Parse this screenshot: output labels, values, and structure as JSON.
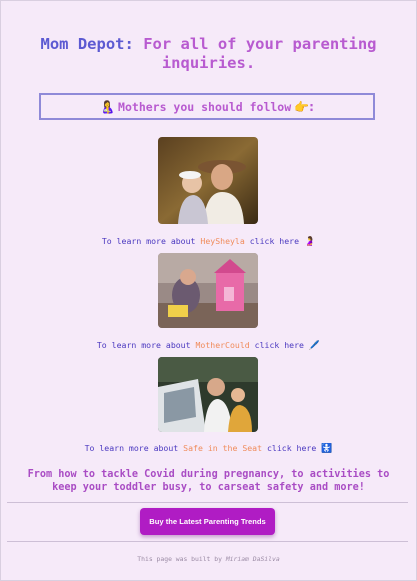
{
  "header": {
    "brand": "Mom Depot:",
    "tagline": "For all of your parenting inquiries."
  },
  "follow_heading": {
    "emoji_left": "🤱",
    "text": "Mothers you should follow",
    "emoji_right": "👉:"
  },
  "mothers": [
    {
      "prefix": "To learn more about",
      "name": "HeySheyla",
      "suffix": "click here",
      "emoji": "🤰"
    },
    {
      "prefix": "To learn more about",
      "name": "MotherCould",
      "suffix": "click here",
      "emoji": "🖊️"
    },
    {
      "prefix": "To learn more about",
      "name": "Safe in the Seat",
      "suffix": "click here",
      "emoji": "🚼"
    }
  ],
  "blurb": "From how to tackle Covid during pregnancy, to activities to keep your toddler busy, to carseat safety and more!",
  "cta_label": "Buy the Latest Parenting Trends",
  "footer": {
    "prefix": "This page was built by",
    "author": "Miriam DaSilva"
  },
  "colors": {
    "background": "#f6eaf9",
    "brand": "#5c5ad2",
    "accent": "#b85bd0",
    "link_name": "#f08c5c",
    "cta": "#b01cc4"
  }
}
